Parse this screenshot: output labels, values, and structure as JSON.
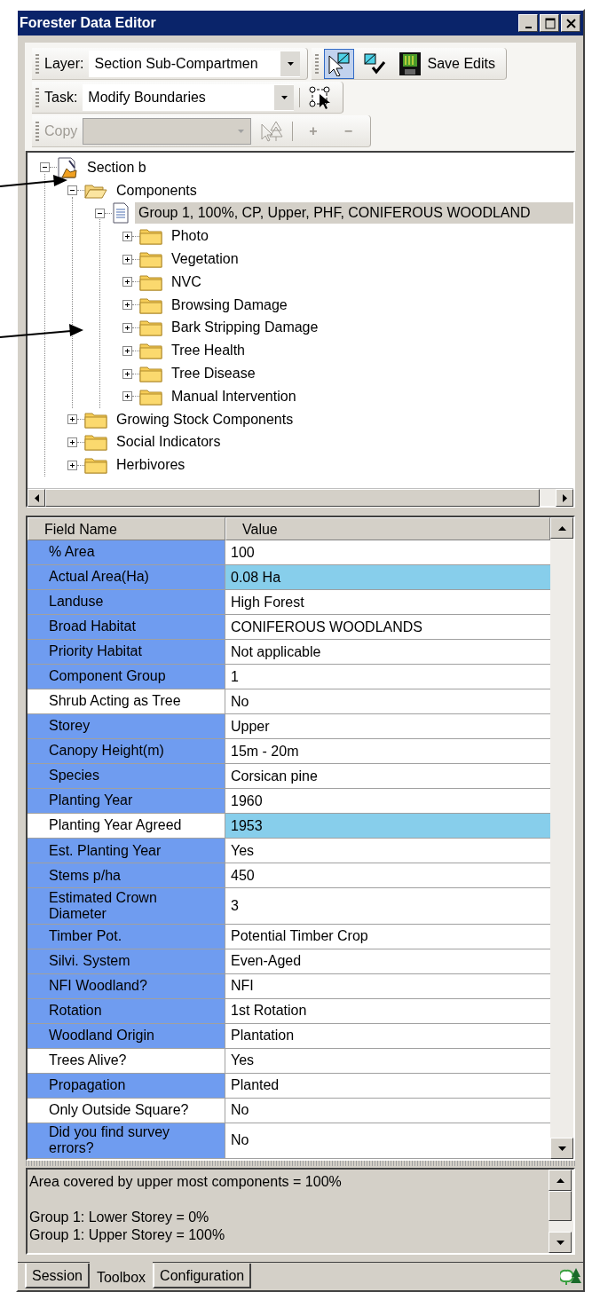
{
  "window": {
    "title": "Forester Data Editor"
  },
  "toolbars": {
    "layer": {
      "label": "Layer:",
      "value": "Section Sub-Compartmen"
    },
    "tools": [
      {
        "pressed": true
      },
      {
        "pressed": false
      }
    ],
    "save": {
      "label": "Save Edits"
    },
    "task": {
      "label": "Task:",
      "value": "Modify Boundaries"
    },
    "copy": {
      "label": "Copy",
      "disabled": true,
      "add": "+",
      "remove": "−"
    }
  },
  "tree": [
    {
      "label": "Section b",
      "kind": "section",
      "expanded": true,
      "selected": false,
      "children": [
        {
          "label": "Components",
          "kind": "folder",
          "expanded": true,
          "selected": false,
          "children": [
            {
              "label": "Group 1, 100%, CP, Upper, PHF, CONIFEROUS WOODLAND",
              "kind": "document",
              "expanded": true,
              "selected": true,
              "children": [
                {
                  "label": "Photo",
                  "kind": "folder",
                  "expanded": false,
                  "selected": false
                },
                {
                  "label": "Vegetation",
                  "kind": "folder",
                  "expanded": false,
                  "selected": false
                },
                {
                  "label": "NVC",
                  "kind": "folder",
                  "expanded": false,
                  "selected": false
                },
                {
                  "label": "Browsing Damage",
                  "kind": "folder",
                  "expanded": false,
                  "selected": false
                },
                {
                  "label": "Bark Stripping Damage",
                  "kind": "folder",
                  "expanded": false,
                  "selected": false
                },
                {
                  "label": "Tree Health",
                  "kind": "folder",
                  "expanded": false,
                  "selected": false
                },
                {
                  "label": "Tree Disease",
                  "kind": "folder",
                  "expanded": false,
                  "selected": false
                },
                {
                  "label": "Manual Intervention",
                  "kind": "folder",
                  "expanded": false,
                  "selected": false
                }
              ]
            }
          ]
        },
        {
          "label": "Growing Stock Components",
          "kind": "folder",
          "expanded": false,
          "selected": false
        },
        {
          "label": "Social Indicators",
          "kind": "folder",
          "expanded": false,
          "selected": false
        },
        {
          "label": "Herbivores",
          "kind": "folder",
          "expanded": false,
          "selected": false
        }
      ]
    }
  ],
  "grid": {
    "columns": [
      "Field Name",
      "Value"
    ],
    "rows": [
      {
        "field": "% Area",
        "value": "100",
        "required": true,
        "highlighted": false
      },
      {
        "field": "Actual Area(Ha)",
        "value": "0.08 Ha",
        "required": true,
        "highlighted": true
      },
      {
        "field": "Landuse",
        "value": "High Forest",
        "required": true,
        "highlighted": false
      },
      {
        "field": "Broad Habitat",
        "value": "CONIFEROUS WOODLANDS",
        "required": true,
        "highlighted": false
      },
      {
        "field": "Priority Habitat",
        "value": "Not applicable",
        "required": true,
        "highlighted": false
      },
      {
        "field": "Component Group",
        "value": "1",
        "required": true,
        "highlighted": false
      },
      {
        "field": "Shrub Acting as Tree",
        "value": "No",
        "required": false,
        "highlighted": false
      },
      {
        "field": "Storey",
        "value": "Upper",
        "required": true,
        "highlighted": false
      },
      {
        "field": "Canopy Height(m)",
        "value": "15m - 20m",
        "required": true,
        "highlighted": false
      },
      {
        "field": "Species",
        "value": "Corsican pine",
        "required": true,
        "highlighted": false
      },
      {
        "field": "Planting Year",
        "value": "1960",
        "required": true,
        "highlighted": false
      },
      {
        "field": "Planting Year Agreed",
        "value": "1953",
        "required": false,
        "highlighted": true
      },
      {
        "field": "Est. Planting Year",
        "value": "Yes",
        "required": true,
        "highlighted": false
      },
      {
        "field": "Stems p/ha",
        "value": "450",
        "required": true,
        "highlighted": false
      },
      {
        "field": "Estimated Crown Diameter",
        "value": "3",
        "required": true,
        "highlighted": false
      },
      {
        "field": "Timber Pot.",
        "value": "Potential Timber Crop",
        "required": true,
        "highlighted": false
      },
      {
        "field": "Silvi. System",
        "value": "Even-Aged",
        "required": true,
        "highlighted": false
      },
      {
        "field": "NFI Woodland?",
        "value": "NFI",
        "required": true,
        "highlighted": false
      },
      {
        "field": "Rotation",
        "value": "1st Rotation",
        "required": true,
        "highlighted": false
      },
      {
        "field": "Woodland Origin",
        "value": "Plantation",
        "required": true,
        "highlighted": false
      },
      {
        "field": "Trees Alive?",
        "value": "Yes",
        "required": false,
        "highlighted": false
      },
      {
        "field": "Propagation",
        "value": "Planted",
        "required": true,
        "highlighted": false
      },
      {
        "field": "Only Outside Square?",
        "value": "No",
        "required": false,
        "highlighted": false
      },
      {
        "field": "Did you find survey errors?",
        "value": "No",
        "required": true,
        "highlighted": false
      }
    ]
  },
  "messages": [
    [
      "Area covered by upper most components = 100%"
    ],
    [
      "Group 1: Lower Storey = 0%",
      "Group 1: Upper Storey = 100%"
    ]
  ],
  "tabs": [
    {
      "label": "Session",
      "selected": false
    },
    {
      "label": "Toolbox",
      "selected": true
    },
    {
      "label": "Configuration",
      "selected": false
    }
  ]
}
